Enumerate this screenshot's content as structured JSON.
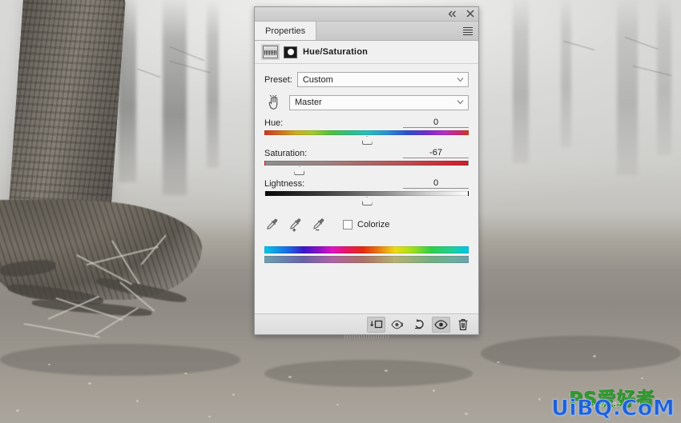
{
  "window": {
    "collapse_icon": "double-chevron-left-icon",
    "close_icon": "close-icon"
  },
  "panel": {
    "tab_label": "Properties",
    "menu_icon": "panel-menu-icon",
    "adjustment_icon": "hue-saturation-adjustment-icon",
    "mask_icon": "layer-mask-thumbnail-icon",
    "adjustment_title": "Hue/Saturation"
  },
  "preset": {
    "label": "Preset:",
    "value": "Custom",
    "caret": "∨"
  },
  "channel": {
    "hand_tool_icon": "on-image-adjustment-hand-icon",
    "value": "Master",
    "caret": "∨"
  },
  "sliders": [
    {
      "label": "Hue:",
      "value": "0",
      "thumb_percent": 50
    },
    {
      "label": "Saturation:",
      "value": "-67",
      "thumb_percent": 17
    },
    {
      "label": "Lightness:",
      "value": "0",
      "thumb_percent": 50
    }
  ],
  "eyedroppers": [
    {
      "name": "eyedropper-icon",
      "glyph": "sample"
    },
    {
      "name": "eyedropper-plus-icon",
      "glyph": "sample-add"
    },
    {
      "name": "eyedropper-minus-icon",
      "glyph": "sample-subtract"
    }
  ],
  "colorize": {
    "label": "Colorize",
    "checked": false
  },
  "footer": {
    "buttons": [
      {
        "name": "clip-to-layer-button",
        "icon": "clip-to-layer-icon",
        "active": true
      },
      {
        "name": "toggle-previous-state-button",
        "icon": "eye-previous-icon",
        "active": false
      },
      {
        "name": "reset-button",
        "icon": "reset-arrow-icon",
        "active": false
      },
      {
        "name": "toggle-visibility-button",
        "icon": "eye-icon",
        "active": true
      },
      {
        "name": "delete-adjustment-button",
        "icon": "trash-icon",
        "active": false
      }
    ]
  },
  "watermark": {
    "top_text": "PS爱好者",
    "mid_text": "www.88z",
    "bottom_text": "UiBQ.CoM"
  },
  "colors": {
    "panel_bg": "#f0f0f0",
    "panel_border": "#9a9a9a",
    "text": "#1e1e1e",
    "watermark_blue": "#1f5fd8",
    "watermark_green": "#2f9a2f"
  }
}
